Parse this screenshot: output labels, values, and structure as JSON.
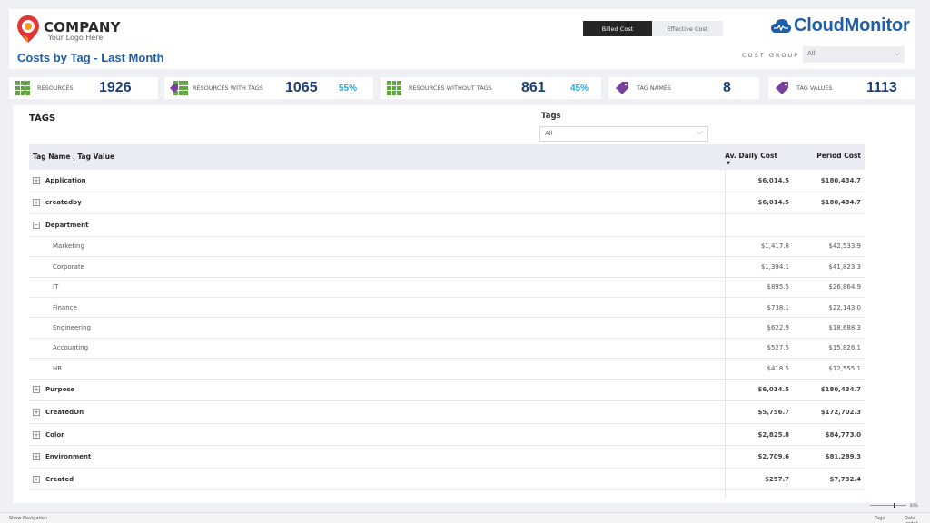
{
  "brand": {
    "company": "COMPANY",
    "tagline": "Your Logo Here",
    "product": "CloudMonitor",
    "pin_color": "#e0363a",
    "accent": "#1f5fa8"
  },
  "page": {
    "title": "Costs by Tag - Last Month"
  },
  "cost_toggle": {
    "active": "Billed Cost",
    "inactive": "Effective Cost"
  },
  "cost_group": {
    "label": "COST GROUP",
    "value": "All"
  },
  "kpis": [
    {
      "label": "RESOURCES",
      "value": "1926",
      "percent": "",
      "icon": "grid-icon"
    },
    {
      "label": "RESOURCES WITH TAGS",
      "value": "1065",
      "percent": "55%",
      "icon": "grid-tag-icon"
    },
    {
      "label": "RESOURCES WITHOUT TAGS",
      "value": "861",
      "percent": "45%",
      "icon": "grid-icon"
    },
    {
      "label": "TAG NAMES",
      "value": "8",
      "percent": "",
      "icon": "tag-icon"
    },
    {
      "label": "TAG VALUES",
      "value": "1113",
      "percent": "",
      "icon": "tag-icon"
    }
  ],
  "tags_panel": {
    "title": "TAGS",
    "filter_label": "Tags",
    "filter_value": "All"
  },
  "table": {
    "columns": [
      "Tag Name | Tag Value",
      "Av. Daily Cost",
      "Period Cost"
    ],
    "rows": [
      {
        "level": "top",
        "expand": "+",
        "name": "Application",
        "daily": "$6,014.5",
        "period": "$180,434.7"
      },
      {
        "level": "top",
        "expand": "+",
        "name": "createdby",
        "daily": "$6,014.5",
        "period": "$180,434.7"
      },
      {
        "level": "top",
        "expand": "−",
        "name": "Department",
        "daily": "",
        "period": ""
      },
      {
        "level": "sub",
        "name": "Marketing",
        "daily": "$1,417.8",
        "period": "$42,533.9"
      },
      {
        "level": "sub",
        "name": "Corporate",
        "daily": "$1,394.1",
        "period": "$41,823.3"
      },
      {
        "level": "sub",
        "name": "IT",
        "daily": "$895.5",
        "period": "$26,864.9"
      },
      {
        "level": "sub",
        "name": "Finance",
        "daily": "$738.1",
        "period": "$22,143.0"
      },
      {
        "level": "sub",
        "name": "Engineering",
        "daily": "$622.9",
        "period": "$18,688.3"
      },
      {
        "level": "sub",
        "name": "Accounting",
        "daily": "$527.5",
        "period": "$15,826.1"
      },
      {
        "level": "sub",
        "name": "HR",
        "daily": "$418.5",
        "period": "$12,555.1"
      },
      {
        "level": "top",
        "expand": "+",
        "name": "Purpose",
        "daily": "$6,014.5",
        "period": "$180,434.7"
      },
      {
        "level": "top",
        "expand": "+",
        "name": "CreatedOn",
        "daily": "$5,756.7",
        "period": "$172,702.3"
      },
      {
        "level": "top",
        "expand": "+",
        "name": "Color",
        "daily": "$2,825.8",
        "period": "$84,773.0"
      },
      {
        "level": "top",
        "expand": "+",
        "name": "Environment",
        "daily": "$2,709.6",
        "period": "$81,289.3"
      },
      {
        "level": "top",
        "expand": "+",
        "name": "Created",
        "daily": "$257.7",
        "period": "$7,732.4"
      }
    ]
  },
  "footer": {
    "nav": "Show Navigation",
    "page_tab": "Tags",
    "update": "Data updat...",
    "zoom": "85%"
  }
}
